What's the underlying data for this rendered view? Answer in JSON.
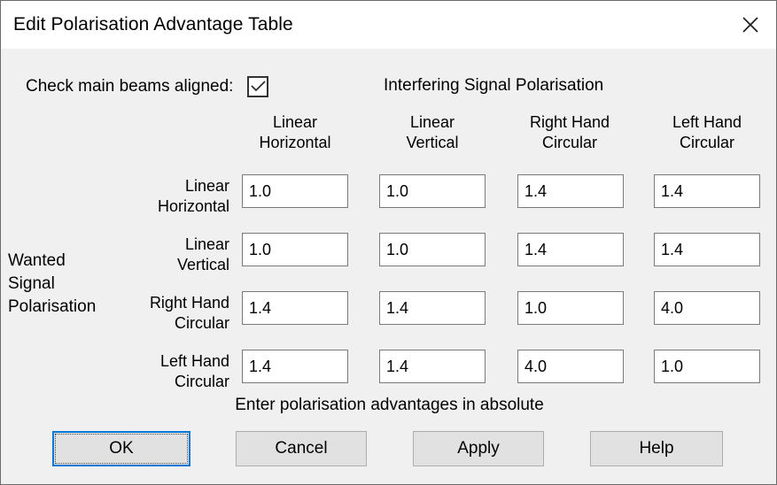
{
  "window": {
    "title": "Edit Polarisation Advantage Table",
    "close_icon": "close-icon",
    "bg_color": "#f0f0f0",
    "titlebar_color": "#ffffff",
    "border_color": "#6b6b6b"
  },
  "options": {
    "check_main_beams_label": "Check main beams aligned:",
    "check_main_beams_checked": true,
    "checkmark_icon": "checkmark-icon"
  },
  "table": {
    "column_group_title": "Interfering Signal Polarisation",
    "row_group_title": [
      "Wanted",
      "Signal",
      "Polarisation"
    ],
    "columns": [
      {
        "line1": "Linear",
        "line2": "Horizontal"
      },
      {
        "line1": "Linear",
        "line2": "Vertical"
      },
      {
        "line1": "Right Hand",
        "line2": "Circular"
      },
      {
        "line1": "Left Hand",
        "line2": "Circular"
      }
    ],
    "rows": [
      {
        "line1": "Linear",
        "line2": "Horizontal",
        "values": [
          "1.0",
          "1.0",
          "1.4",
          "1.4"
        ]
      },
      {
        "line1": "Linear",
        "line2": "Vertical",
        "values": [
          "1.0",
          "1.0",
          "1.4",
          "1.4"
        ]
      },
      {
        "line1": "Right Hand",
        "line2": "Circular",
        "values": [
          "1.4",
          "1.4",
          "1.0",
          "4.0"
        ]
      },
      {
        "line1": "Left Hand",
        "line2": "Circular",
        "values": [
          "1.4",
          "1.4",
          "4.0",
          "1.0"
        ]
      }
    ],
    "hint": "Enter polarisation advantages in absolute"
  },
  "buttons": {
    "ok": "OK",
    "cancel": "Cancel",
    "apply": "Apply",
    "help": "Help",
    "focus_color": "#0078d7"
  }
}
